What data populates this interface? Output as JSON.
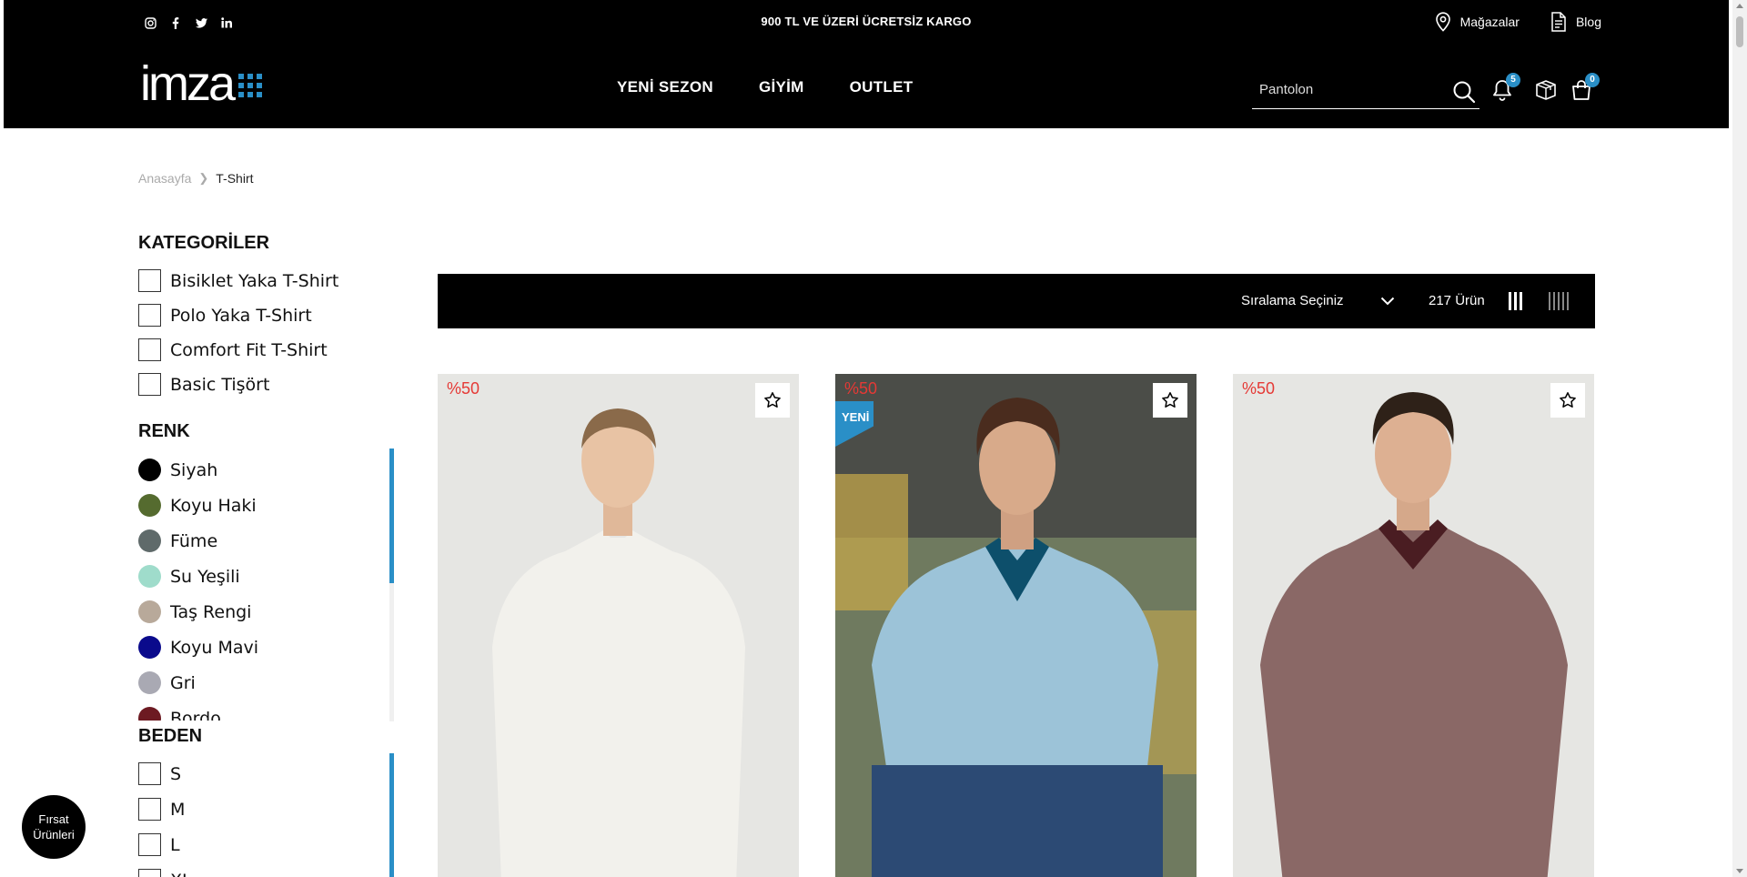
{
  "topbar": {
    "socials": [
      {
        "name": "instagram-icon",
        "glyph": "◎"
      },
      {
        "name": "facebook-icon",
        "glyph": "f"
      },
      {
        "name": "twitter-icon",
        "glyph": "🐦"
      },
      {
        "name": "linkedin-icon",
        "glyph": "in"
      }
    ],
    "announcement": "900 TL VE ÜZERİ ÜCRETSİZ KARGO",
    "stores_label": "Mağazalar",
    "blog_label": "Blog"
  },
  "logo": {
    "text": "imza"
  },
  "nav": {
    "items": [
      "YENİ SEZON",
      "GİYİM",
      "OUTLET"
    ]
  },
  "search": {
    "placeholder": "Pantolon"
  },
  "header_icons": {
    "notifications_count": "5",
    "cart_count": "0"
  },
  "breadcrumb": {
    "home": "Anasayfa",
    "current": "T-Shirt"
  },
  "filters": {
    "categories_title": "KATEGORİLER",
    "categories": [
      "Bisiklet Yaka T-Shirt",
      "Polo Yaka T-Shirt",
      "Comfort Fit T-Shirt",
      "Basic Tişört"
    ],
    "color_title": "RENK",
    "colors": [
      {
        "label": "Siyah",
        "hex": "#000000"
      },
      {
        "label": "Koyu Haki",
        "hex": "#556b2f"
      },
      {
        "label": "Füme",
        "hex": "#5f6a6a"
      },
      {
        "label": "Su Yeşili",
        "hex": "#9fdccb"
      },
      {
        "label": "Taş Rengi",
        "hex": "#b8a99a"
      },
      {
        "label": "Koyu Mavi",
        "hex": "#0a0a8c"
      },
      {
        "label": "Gri",
        "hex": "#a9a9b3"
      },
      {
        "label": "Bordo",
        "hex": "#6d1a22"
      }
    ],
    "size_title": "BEDEN",
    "sizes": [
      "S",
      "M",
      "L",
      "XL"
    ]
  },
  "toolbar": {
    "sort_label": "Sıralama Seçiniz",
    "count_label": "217 Ürün"
  },
  "products": [
    {
      "discount": "%50",
      "new_label": "",
      "shirt_color": "#f2f1ec",
      "collar_color": "#f2f1ec"
    },
    {
      "discount": "%50",
      "new_label": "YENİ",
      "shirt_color": "#9cc3d8",
      "collar_color": "#0d4f6b"
    },
    {
      "discount": "%50",
      "new_label": "",
      "shirt_color": "#8a6866",
      "collar_color": "#4a1d22"
    }
  ],
  "fab": {
    "line1": "Fırsat",
    "line2": "Ürünleri"
  },
  "colors": {
    "accent": "#2a8fc7",
    "discount": "#e53935",
    "header_bg": "#000000"
  }
}
